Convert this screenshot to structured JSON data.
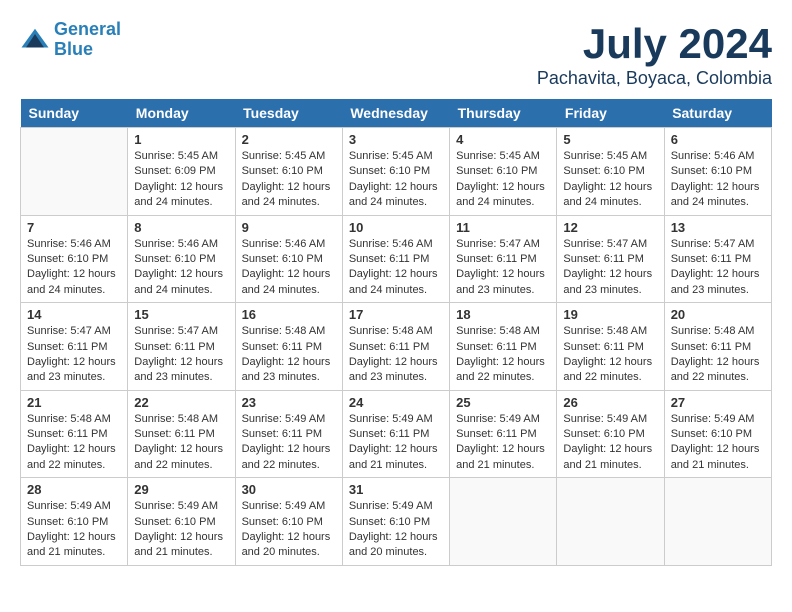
{
  "header": {
    "logo_line1": "General",
    "logo_line2": "Blue",
    "month_year": "July 2024",
    "location": "Pachavita, Boyaca, Colombia"
  },
  "days_of_week": [
    "Sunday",
    "Monday",
    "Tuesday",
    "Wednesday",
    "Thursday",
    "Friday",
    "Saturday"
  ],
  "weeks": [
    [
      {
        "num": "",
        "info": ""
      },
      {
        "num": "1",
        "info": "Sunrise: 5:45 AM\nSunset: 6:09 PM\nDaylight: 12 hours\nand 24 minutes."
      },
      {
        "num": "2",
        "info": "Sunrise: 5:45 AM\nSunset: 6:10 PM\nDaylight: 12 hours\nand 24 minutes."
      },
      {
        "num": "3",
        "info": "Sunrise: 5:45 AM\nSunset: 6:10 PM\nDaylight: 12 hours\nand 24 minutes."
      },
      {
        "num": "4",
        "info": "Sunrise: 5:45 AM\nSunset: 6:10 PM\nDaylight: 12 hours\nand 24 minutes."
      },
      {
        "num": "5",
        "info": "Sunrise: 5:45 AM\nSunset: 6:10 PM\nDaylight: 12 hours\nand 24 minutes."
      },
      {
        "num": "6",
        "info": "Sunrise: 5:46 AM\nSunset: 6:10 PM\nDaylight: 12 hours\nand 24 minutes."
      }
    ],
    [
      {
        "num": "7",
        "info": "Sunrise: 5:46 AM\nSunset: 6:10 PM\nDaylight: 12 hours\nand 24 minutes."
      },
      {
        "num": "8",
        "info": "Sunrise: 5:46 AM\nSunset: 6:10 PM\nDaylight: 12 hours\nand 24 minutes."
      },
      {
        "num": "9",
        "info": "Sunrise: 5:46 AM\nSunset: 6:10 PM\nDaylight: 12 hours\nand 24 minutes."
      },
      {
        "num": "10",
        "info": "Sunrise: 5:46 AM\nSunset: 6:11 PM\nDaylight: 12 hours\nand 24 minutes."
      },
      {
        "num": "11",
        "info": "Sunrise: 5:47 AM\nSunset: 6:11 PM\nDaylight: 12 hours\nand 23 minutes."
      },
      {
        "num": "12",
        "info": "Sunrise: 5:47 AM\nSunset: 6:11 PM\nDaylight: 12 hours\nand 23 minutes."
      },
      {
        "num": "13",
        "info": "Sunrise: 5:47 AM\nSunset: 6:11 PM\nDaylight: 12 hours\nand 23 minutes."
      }
    ],
    [
      {
        "num": "14",
        "info": "Sunrise: 5:47 AM\nSunset: 6:11 PM\nDaylight: 12 hours\nand 23 minutes."
      },
      {
        "num": "15",
        "info": "Sunrise: 5:47 AM\nSunset: 6:11 PM\nDaylight: 12 hours\nand 23 minutes."
      },
      {
        "num": "16",
        "info": "Sunrise: 5:48 AM\nSunset: 6:11 PM\nDaylight: 12 hours\nand 23 minutes."
      },
      {
        "num": "17",
        "info": "Sunrise: 5:48 AM\nSunset: 6:11 PM\nDaylight: 12 hours\nand 23 minutes."
      },
      {
        "num": "18",
        "info": "Sunrise: 5:48 AM\nSunset: 6:11 PM\nDaylight: 12 hours\nand 22 minutes."
      },
      {
        "num": "19",
        "info": "Sunrise: 5:48 AM\nSunset: 6:11 PM\nDaylight: 12 hours\nand 22 minutes."
      },
      {
        "num": "20",
        "info": "Sunrise: 5:48 AM\nSunset: 6:11 PM\nDaylight: 12 hours\nand 22 minutes."
      }
    ],
    [
      {
        "num": "21",
        "info": "Sunrise: 5:48 AM\nSunset: 6:11 PM\nDaylight: 12 hours\nand 22 minutes."
      },
      {
        "num": "22",
        "info": "Sunrise: 5:48 AM\nSunset: 6:11 PM\nDaylight: 12 hours\nand 22 minutes."
      },
      {
        "num": "23",
        "info": "Sunrise: 5:49 AM\nSunset: 6:11 PM\nDaylight: 12 hours\nand 22 minutes."
      },
      {
        "num": "24",
        "info": "Sunrise: 5:49 AM\nSunset: 6:11 PM\nDaylight: 12 hours\nand 21 minutes."
      },
      {
        "num": "25",
        "info": "Sunrise: 5:49 AM\nSunset: 6:11 PM\nDaylight: 12 hours\nand 21 minutes."
      },
      {
        "num": "26",
        "info": "Sunrise: 5:49 AM\nSunset: 6:10 PM\nDaylight: 12 hours\nand 21 minutes."
      },
      {
        "num": "27",
        "info": "Sunrise: 5:49 AM\nSunset: 6:10 PM\nDaylight: 12 hours\nand 21 minutes."
      }
    ],
    [
      {
        "num": "28",
        "info": "Sunrise: 5:49 AM\nSunset: 6:10 PM\nDaylight: 12 hours\nand 21 minutes."
      },
      {
        "num": "29",
        "info": "Sunrise: 5:49 AM\nSunset: 6:10 PM\nDaylight: 12 hours\nand 21 minutes."
      },
      {
        "num": "30",
        "info": "Sunrise: 5:49 AM\nSunset: 6:10 PM\nDaylight: 12 hours\nand 20 minutes."
      },
      {
        "num": "31",
        "info": "Sunrise: 5:49 AM\nSunset: 6:10 PM\nDaylight: 12 hours\nand 20 minutes."
      },
      {
        "num": "",
        "info": ""
      },
      {
        "num": "",
        "info": ""
      },
      {
        "num": "",
        "info": ""
      }
    ]
  ]
}
